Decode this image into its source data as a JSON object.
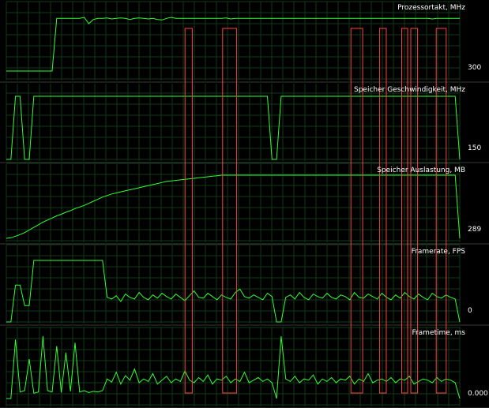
{
  "colors": {
    "background": "#000000",
    "grid": "#0f3a18",
    "trace": "#33ff33",
    "trace_flat": "#e8ff9a",
    "marker": "#ff4040",
    "text": "#ffffff"
  },
  "chart_data": [
    {
      "type": "line",
      "title": "Prozessortakt, MHz",
      "value_label": "300",
      "series": [
        {
          "values": [
            300,
            300,
            300,
            300,
            300,
            300,
            300,
            300,
            300,
            300,
            300,
            1300,
            1300,
            1300,
            1300,
            1300,
            1300,
            1320,
            1200,
            1280,
            1300,
            1300,
            1310,
            1290,
            1300,
            1310,
            1300,
            1280,
            1300,
            1310,
            1300,
            1290,
            1300,
            1280,
            1270,
            1300,
            1320,
            1300,
            1300,
            1300,
            1300,
            1300,
            1300,
            1300,
            1300,
            1300,
            1300,
            1300,
            1310,
            1290,
            1300,
            1300,
            1300,
            1300,
            1300,
            1300,
            1300,
            1300,
            1300,
            1300,
            1300,
            1300,
            1300,
            1300,
            1300,
            1300,
            1300,
            1300,
            1300,
            1300,
            1300,
            1300,
            1300,
            1300,
            1300,
            1300,
            1300,
            1300,
            1300,
            1300,
            1300,
            1300,
            1300,
            1300,
            1300,
            1300,
            1300,
            1300,
            1300,
            1300,
            1300,
            1300,
            1300,
            1290,
            1300,
            1300,
            1300,
            1300,
            1300,
            1300
          ]
        }
      ]
    },
    {
      "type": "line",
      "title": "Speicher Geschwindigkeit, MHz",
      "value_label": "150",
      "series": [
        {
          "values": [
            150,
            150,
            1000,
            1000,
            150,
            150,
            1000,
            1000,
            1000,
            1000,
            1000,
            1000,
            1000,
            1000,
            1000,
            1000,
            1000,
            1000,
            1000,
            1000,
            1000,
            1000,
            1000,
            1000,
            1000,
            1000,
            1000,
            1000,
            1000,
            1000,
            1000,
            1000,
            1000,
            1000,
            1000,
            1000,
            1000,
            1000,
            1000,
            1000,
            1000,
            1000,
            1000,
            1000,
            1000,
            1000,
            1000,
            1000,
            1000,
            1000,
            1000,
            1000,
            1000,
            1000,
            1000,
            1000,
            1000,
            1000,
            150,
            150,
            1000,
            1000,
            1000,
            1000,
            1000,
            1000,
            1000,
            1000,
            1000,
            1000,
            1000,
            1000,
            1000,
            1000,
            1000,
            1000,
            1000,
            1000,
            1000,
            1000,
            1000,
            1000,
            1000,
            1000,
            1000,
            1000,
            1000,
            1000,
            1000,
            1000,
            1000,
            1000,
            1000,
            1000,
            1000,
            1000,
            1000,
            1000,
            1000,
            150
          ]
        }
      ]
    },
    {
      "type": "line",
      "title": "Speicher Auslastung, MB",
      "value_label": "289",
      "series": [
        {
          "values": [
            289,
            300,
            330,
            360,
            400,
            450,
            500,
            550,
            600,
            640,
            680,
            720,
            750,
            790,
            820,
            860,
            890,
            920,
            960,
            1000,
            1040,
            1080,
            1110,
            1140,
            1160,
            1180,
            1200,
            1220,
            1240,
            1260,
            1280,
            1300,
            1320,
            1340,
            1360,
            1380,
            1390,
            1400,
            1410,
            1420,
            1430,
            1440,
            1450,
            1460,
            1470,
            1480,
            1490,
            1500,
            1500,
            1500,
            1500,
            1500,
            1500,
            1500,
            1500,
            1500,
            1500,
            1500,
            1500,
            1500,
            1500,
            1500,
            1500,
            1500,
            1500,
            1500,
            1500,
            1500,
            1500,
            1500,
            1500,
            1500,
            1500,
            1500,
            1500,
            1500,
            1500,
            1500,
            1500,
            1500,
            1500,
            1500,
            1500,
            1500,
            1500,
            1500,
            1500,
            1500,
            1500,
            1500,
            1500,
            1500,
            1500,
            1500,
            1500,
            1500,
            1500,
            1500,
            1500,
            289
          ]
        }
      ]
    },
    {
      "type": "line",
      "title": "Framerate, FPS",
      "value_label": "0",
      "series": [
        {
          "values": [
            0,
            0,
            45,
            45,
            20,
            20,
            75,
            75,
            75,
            75,
            75,
            75,
            75,
            75,
            75,
            75,
            75,
            75,
            75,
            75,
            75,
            75,
            30,
            28,
            32,
            25,
            34,
            30,
            28,
            36,
            30,
            27,
            33,
            29,
            35,
            31,
            28,
            34,
            30,
            26,
            32,
            38,
            30,
            29,
            35,
            31,
            27,
            33,
            30,
            28,
            36,
            40,
            31,
            29,
            33,
            30,
            27,
            35,
            31,
            0,
            0,
            30,
            33,
            28,
            36,
            30,
            27,
            34,
            31,
            29,
            35,
            30,
            28,
            33,
            31,
            27,
            36,
            30,
            29,
            34,
            31,
            28,
            35,
            30,
            27,
            33,
            29,
            36,
            31,
            28,
            34,
            30,
            27,
            35,
            31,
            29,
            33,
            30,
            28,
            0
          ]
        }
      ]
    },
    {
      "type": "line",
      "title": "Frametime, ms",
      "value_label": "0.000",
      "series": [
        {
          "values": [
            0,
            0,
            90,
            10,
            12,
            60,
            8,
            10,
            95,
            12,
            10,
            80,
            9,
            70,
            11,
            85,
            10,
            12,
            9,
            11,
            10,
            12,
            30,
            25,
            40,
            22,
            35,
            28,
            45,
            24,
            30,
            26,
            38,
            22,
            28,
            34,
            24,
            30,
            26,
            42,
            28,
            24,
            32,
            26,
            36,
            22,
            30,
            28,
            34,
            24,
            30,
            26,
            40,
            24,
            28,
            32,
            26,
            30,
            24,
            0,
            95,
            30,
            26,
            34,
            24,
            30,
            28,
            36,
            22,
            30,
            26,
            32,
            24,
            30,
            28,
            34,
            22,
            30,
            26,
            38,
            24,
            28,
            30,
            26,
            32,
            24,
            30,
            28,
            34,
            22,
            26,
            30,
            28,
            24,
            32,
            26,
            30,
            28,
            24,
            0
          ]
        }
      ]
    }
  ],
  "markers": [
    {
      "from": 0.394,
      "to": 0.41
    },
    {
      "from": 0.477,
      "to": 0.508
    },
    {
      "from": 0.76,
      "to": 0.786
    },
    {
      "from": 0.823,
      "to": 0.838
    },
    {
      "from": 0.872,
      "to": 0.885
    },
    {
      "from": 0.892,
      "to": 0.907
    },
    {
      "from": 0.948,
      "to": 0.97
    }
  ]
}
